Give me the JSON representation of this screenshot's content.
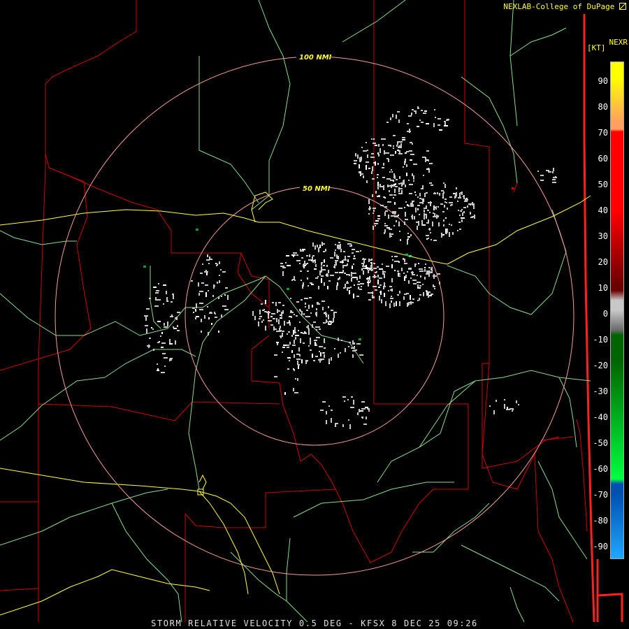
{
  "header": {
    "credit": "NEXLAB-College of DuPage",
    "credit_icon": "nexlab-logo-icon",
    "product": "NEXR"
  },
  "rings": [
    {
      "label": "50 NMI"
    },
    {
      "label": "100 NMI"
    }
  ],
  "legend": {
    "unit": "[KT]",
    "ticks": [
      "90",
      "80",
      "70",
      "60",
      "50",
      "40",
      "30",
      "20",
      "10",
      "0",
      "-10",
      "-20",
      "-30",
      "-40",
      "-50",
      "-60",
      "-70",
      "-80",
      "-90"
    ],
    "value_range": [
      -95,
      95
    ],
    "colors": {
      "top": "#ffff00",
      "orange": "#ffa060",
      "red_hi": "#ff0000",
      "red_lo": "#6a0000",
      "neutral_hi": "#c8c8c8",
      "neutral_lo": "#6a6a6a",
      "green_lo": "#006400",
      "green_hi": "#00ff40",
      "blue_lo": "#0050b0",
      "blue_hi": "#20a8ff"
    }
  },
  "map_colors": {
    "state_lines": "#ff2020",
    "county_lines": "#cc0000",
    "rivers_roads": "#90d890",
    "highways": "#ffff40",
    "range_rings": "#f0a0a0",
    "echo": "#c8c8c8"
  },
  "footer": {
    "text": "STORM RELATIVE VELOCITY 0.5 DEG - KFSX 8 DEC 25 09:26"
  }
}
